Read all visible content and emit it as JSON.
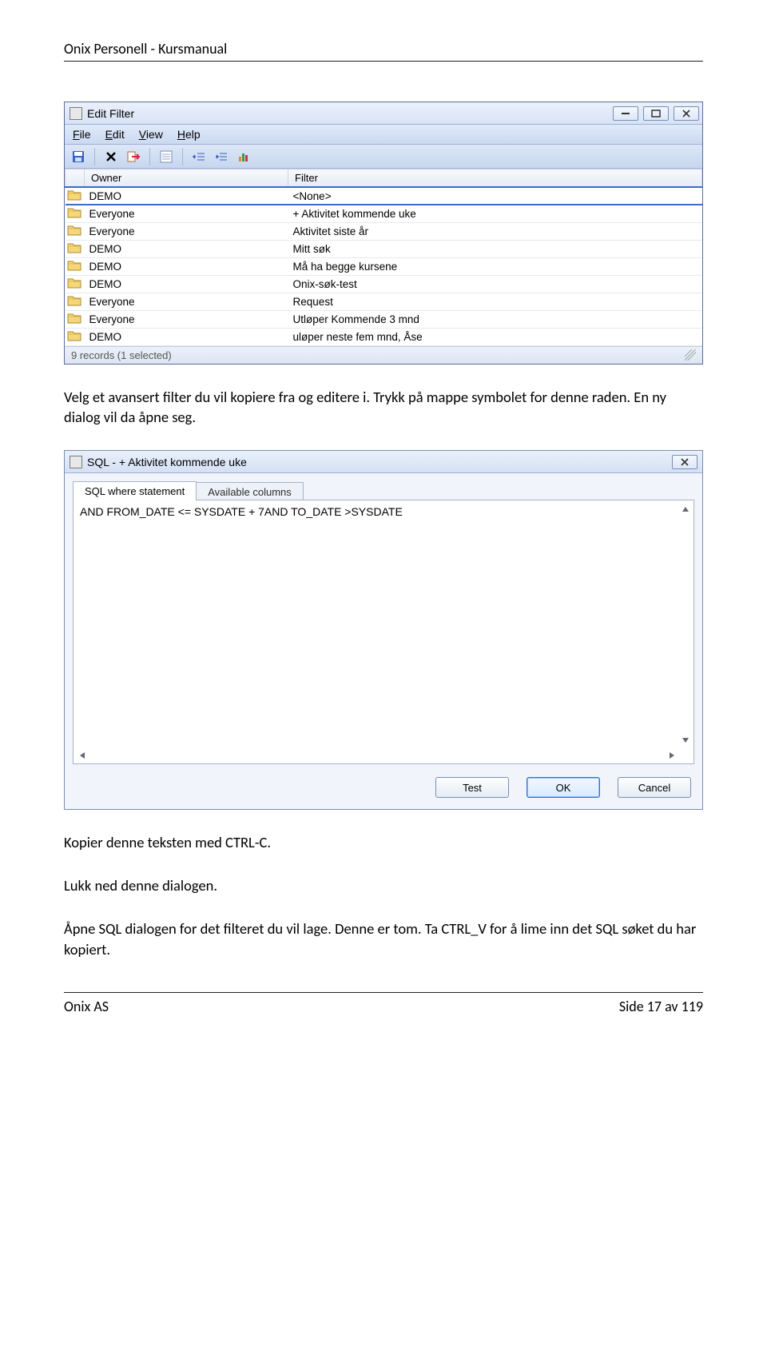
{
  "doc": {
    "header_title": "Onix Personell - Kursmanual",
    "footer_left": "Onix AS",
    "footer_right": "Side 17 av 119"
  },
  "edit_filter": {
    "title": "Edit Filter",
    "menu": {
      "file": "File",
      "edit": "Edit",
      "view": "View",
      "help": "Help"
    },
    "columns": {
      "owner": "Owner",
      "filter": "Filter"
    },
    "rows": [
      {
        "owner": "DEMO",
        "filter": "<None>",
        "selected": true
      },
      {
        "owner": "Everyone",
        "filter": "+ Aktivitet kommende uke"
      },
      {
        "owner": "Everyone",
        "filter": "Aktivitet siste år"
      },
      {
        "owner": "DEMO",
        "filter": "Mitt søk"
      },
      {
        "owner": "DEMO",
        "filter": "Må ha begge kursene"
      },
      {
        "owner": "DEMO",
        "filter": "Onix-søk-test"
      },
      {
        "owner": "Everyone",
        "filter": "Request"
      },
      {
        "owner": "Everyone",
        "filter": "Utløper Kommende 3 mnd"
      },
      {
        "owner": "DEMO",
        "filter": "uløper neste fem mnd, Åse"
      }
    ],
    "status": "9 records (1 selected)"
  },
  "paragraph1": "Velg et avansert filter du vil kopiere fra og editere i. Trykk på mappe symbolet for denne raden. En ny dialog vil da åpne seg.",
  "sql_dialog": {
    "title": "SQL - + Aktivitet kommende uke",
    "tab_active": "SQL where statement",
    "tab_inactive": "Available columns",
    "sql_text": "AND FROM_DATE <= SYSDATE + 7AND TO_DATE >SYSDATE",
    "btn_test": "Test",
    "btn_ok": "OK",
    "btn_cancel": "Cancel"
  },
  "p_copy": "Kopier denne teksten med CTRL-C.",
  "p_close": "Lukk ned denne dialogen.",
  "p_open_paste": "Åpne SQL dialogen for det filteret du vil lage. Denne er tom. Ta CTRL_V for å lime inn det SQL søket du har kopiert."
}
